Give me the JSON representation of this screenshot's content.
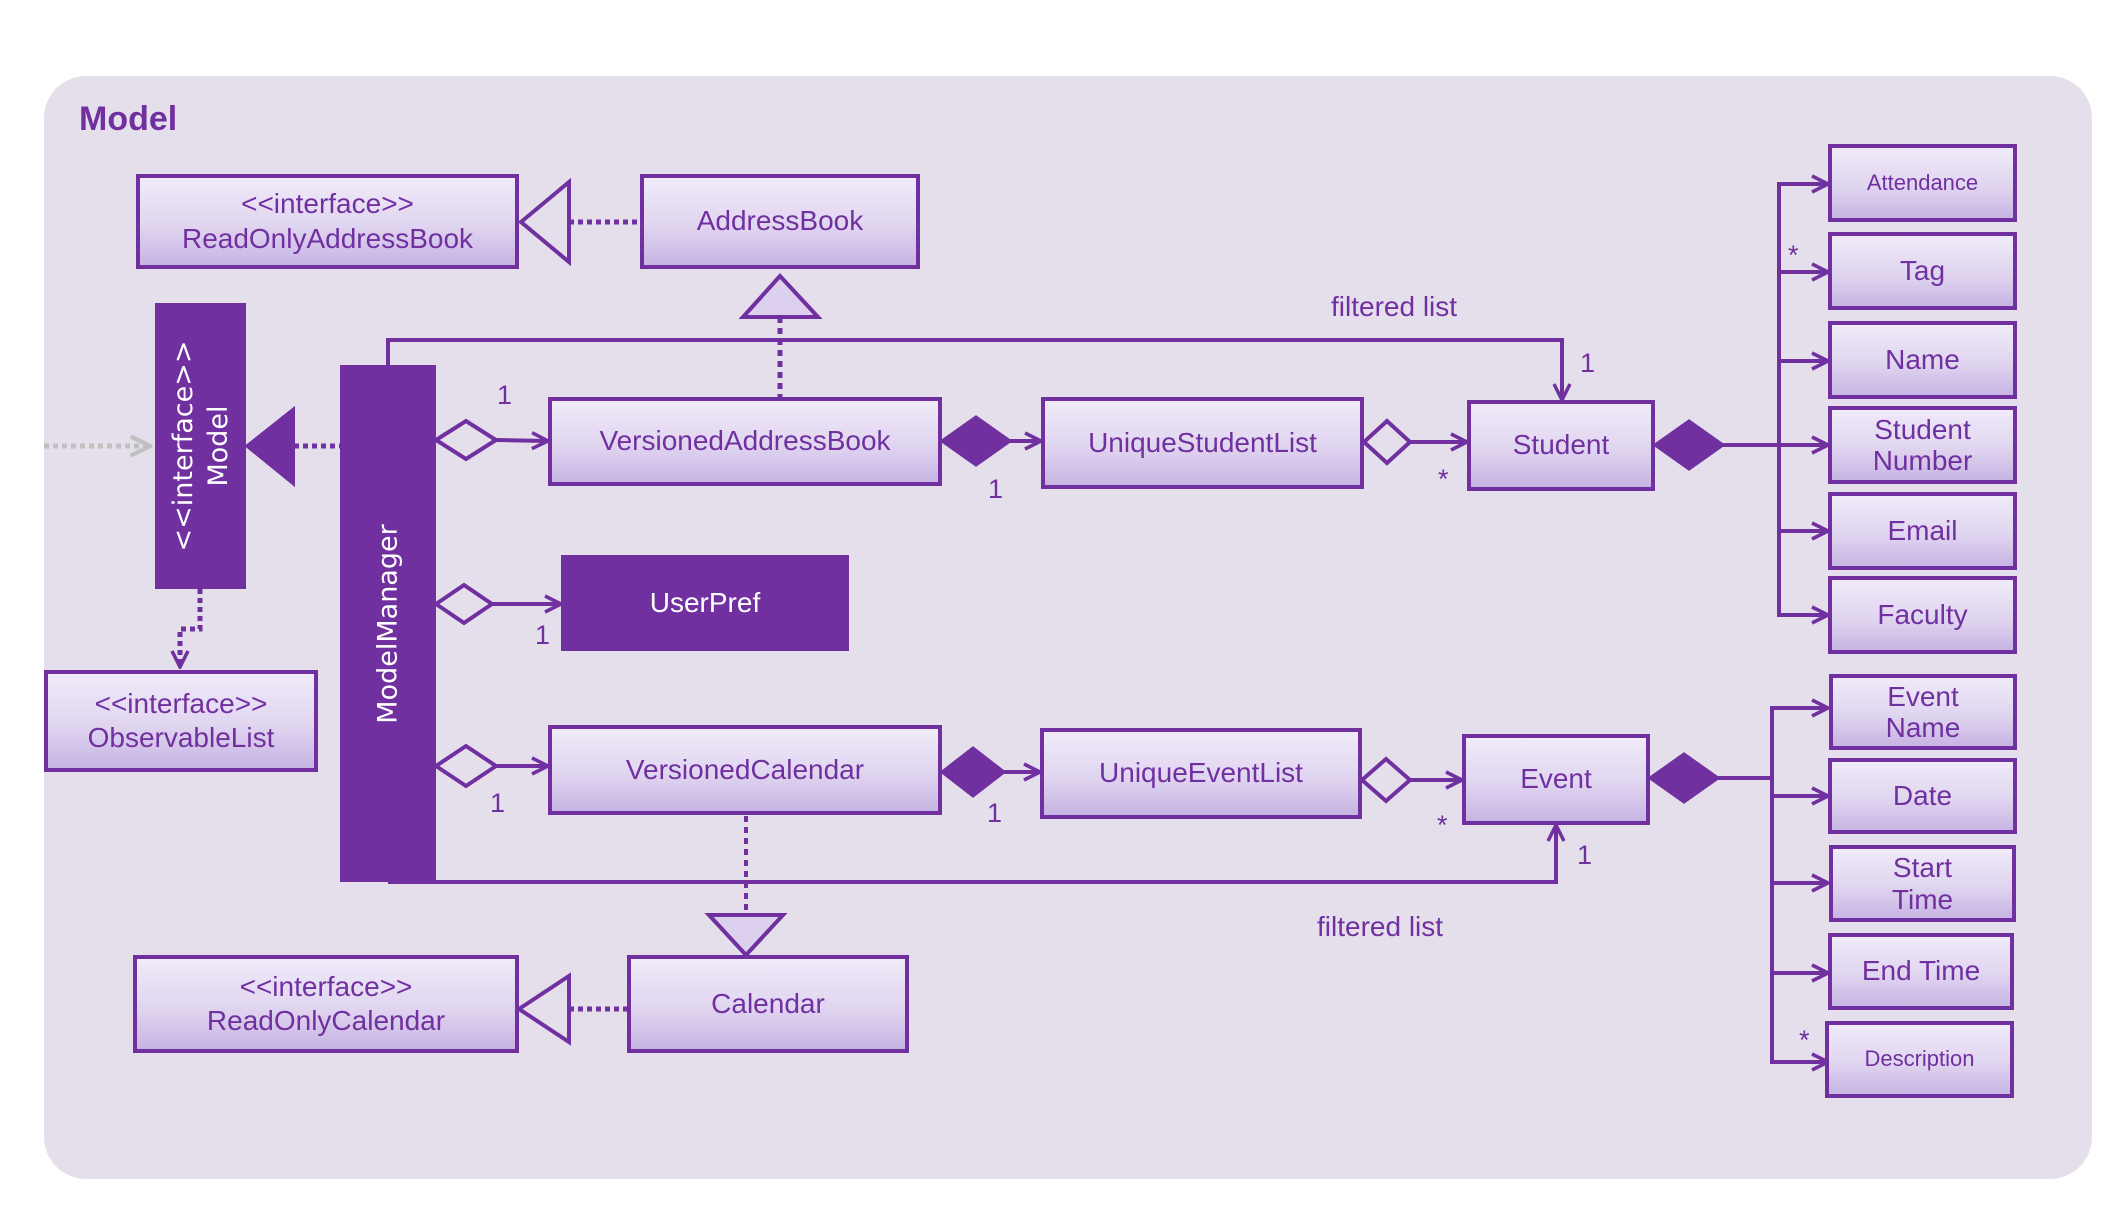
{
  "diagram": {
    "package_title": "Model",
    "colors": {
      "accent": "#7030a0",
      "panel": "#e5dfec",
      "box_top": "#f0eaf9",
      "box_bottom": "#c7b4e3",
      "external_arrow": "#c0c0c0"
    },
    "boxes": {
      "read_only_address_book": {
        "stereotype": "<<interface>>",
        "name": "ReadOnlyAddressBook"
      },
      "address_book": {
        "name": "AddressBook"
      },
      "model": {
        "stereotype": "<<interface>>",
        "name": "Model"
      },
      "model_manager": {
        "name": "ModelManager"
      },
      "observable_list": {
        "stereotype": "<<interface>>",
        "name": "ObservableList"
      },
      "versioned_address_book": {
        "name": "VersionedAddressBook"
      },
      "unique_student_list": {
        "name": "UniqueStudentList"
      },
      "student": {
        "name": "Student"
      },
      "user_pref": {
        "name": "UserPref"
      },
      "versioned_calendar": {
        "name": "VersionedCalendar"
      },
      "unique_event_list": {
        "name": "UniqueEventList"
      },
      "event": {
        "name": "Event"
      },
      "calendar": {
        "name": "Calendar"
      },
      "read_only_calendar": {
        "stereotype": "<<interface>>",
        "name": "ReadOnlyCalendar"
      }
    },
    "student_attributes": [
      {
        "line1": "Attendance",
        "line2": ""
      },
      {
        "line1": "Tag",
        "line2": ""
      },
      {
        "line1": "Name",
        "line2": ""
      },
      {
        "line1": "Student",
        "line2": "Number"
      },
      {
        "line1": "Email",
        "line2": ""
      },
      {
        "line1": "Faculty",
        "line2": ""
      }
    ],
    "event_attributes": [
      {
        "line1": "Event",
        "line2": "Name"
      },
      {
        "line1": "Date",
        "line2": ""
      },
      {
        "line1": "Start",
        "line2": "Time"
      },
      {
        "line1": "End Time",
        "line2": ""
      },
      {
        "line1": "Description",
        "line2": ""
      }
    ],
    "labels": {
      "filtered_list_top": "filtered list",
      "filtered_list_bottom": "filtered list"
    },
    "multiplicities": {
      "mm_vab": "1",
      "vab_usl": "1",
      "usl_student": "*",
      "filtered_student": "1",
      "mm_userpref": "1",
      "mm_vc": "1",
      "vc_uel": "1",
      "uel_event": "*",
      "filtered_event": "1",
      "student_tag": "*",
      "event_description": "*"
    }
  }
}
